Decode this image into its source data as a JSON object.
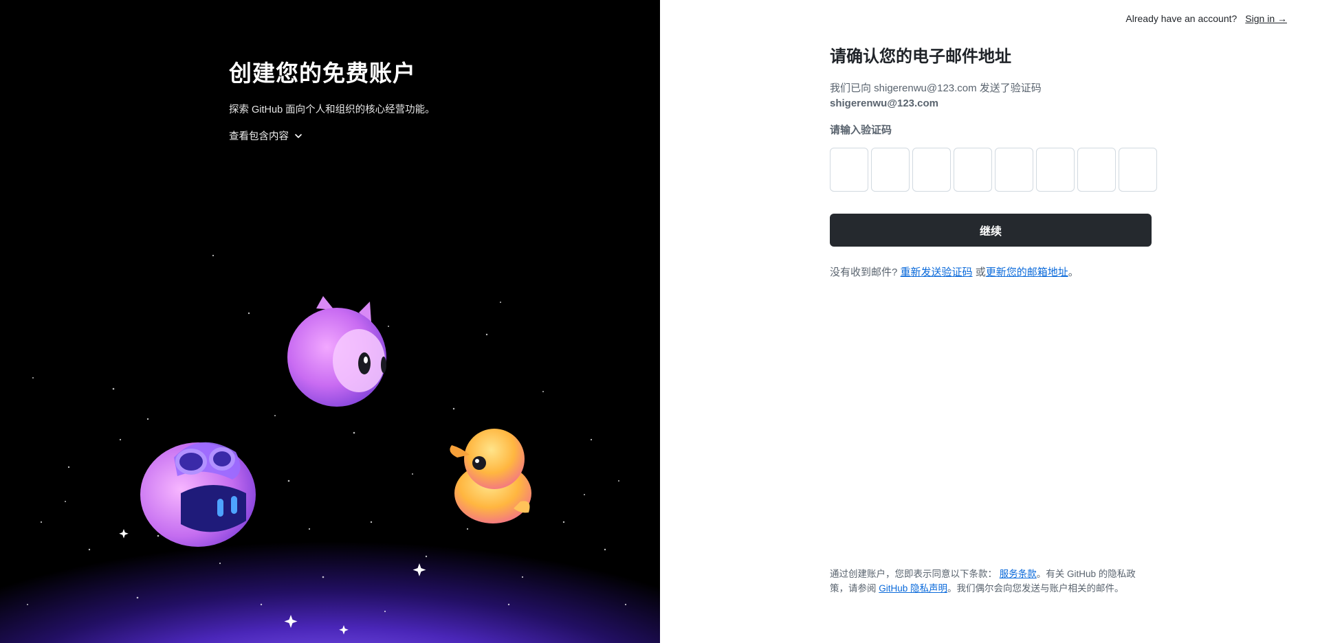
{
  "hero": {
    "title": "创建您的免费账户",
    "subtitle": "探索 GitHub 面向个人和组织的核心经营功能。",
    "toggle_label": "查看包含内容"
  },
  "mascots": [
    "octocat-mascot",
    "copilot-mascot",
    "duck-mascot"
  ],
  "topbar": {
    "question": "Already have an account?",
    "signin_label": "Sign in →"
  },
  "form": {
    "title": "请确认您的电子邮件地址",
    "sent_prefix": "我们已向 shigerenwu@123.com 发送了验证码",
    "email": "shigerenwu@123.com",
    "code_label": "请输入验证码",
    "code_digits": [
      "",
      "",
      "",
      "",
      "",
      "",
      "",
      ""
    ],
    "continue_label": "继续",
    "resend_prefix": "没有收到邮件?",
    "resend_link": "重新发送验证码",
    "or_text": " 或",
    "update_link": "更新您的邮箱地址",
    "end_punct": "。"
  },
  "terms": {
    "part1": "通过创建账户，您即表示同意以下条款：",
    "tos_link": "服务条款",
    "part2": "。有关 GitHub 的隐私政策，请参阅 ",
    "privacy_link": "GitHub 隐私声明",
    "part3": "。我们偶尔会向您发送与账户相关的邮件。"
  },
  "colors": {
    "button_bg": "#25292e",
    "link": "#0969da",
    "hero_glow": "#7b54f0"
  }
}
